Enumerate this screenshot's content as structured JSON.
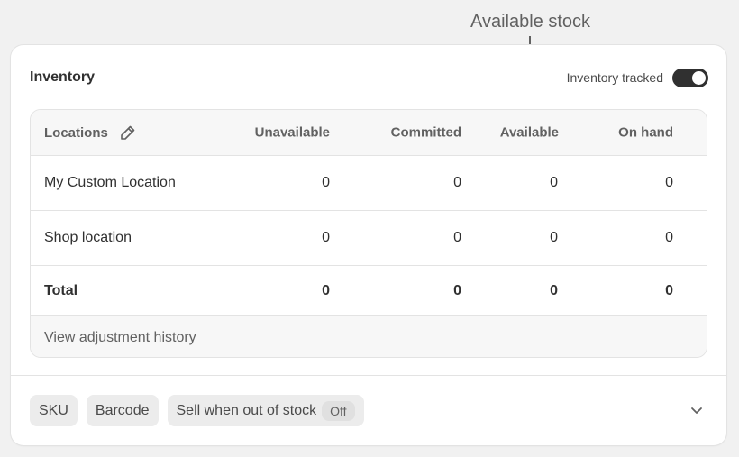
{
  "annotation": {
    "label": "Available stock"
  },
  "card": {
    "title": "Inventory",
    "tracked_label": "Inventory tracked",
    "tracked_on": true
  },
  "table": {
    "headers": {
      "locations": "Locations",
      "unavailable": "Unavailable",
      "committed": "Committed",
      "available": "Available",
      "on_hand": "On hand"
    },
    "rows": [
      {
        "location": "My Custom Location",
        "unavailable": "0",
        "committed": "0",
        "available": "0",
        "on_hand": "0"
      },
      {
        "location": "Shop location",
        "unavailable": "0",
        "committed": "0",
        "available": "0",
        "on_hand": "0"
      }
    ],
    "total": {
      "label": "Total",
      "unavailable": "0",
      "committed": "0",
      "available": "0",
      "on_hand": "0"
    },
    "history_link": "View adjustment history"
  },
  "chips": {
    "sku": "SKU",
    "barcode": "Barcode",
    "sell_oos": "Sell when out of stock",
    "sell_oos_state": "Off"
  },
  "icons": {
    "edit": "pencil-icon",
    "expand": "chevron-down-icon",
    "pointer": "arrow-down-icon"
  },
  "colors": {
    "toggle_on": "#303030",
    "card_bg": "#ffffff",
    "page_bg": "#f1f1f1"
  }
}
